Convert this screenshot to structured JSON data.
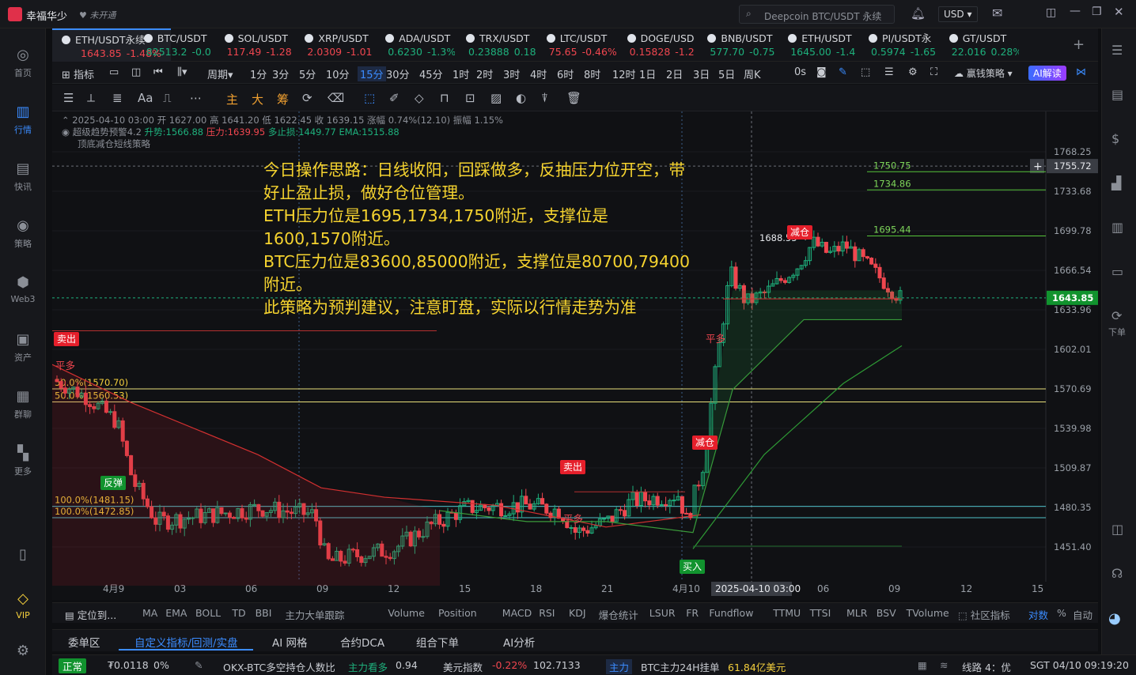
{
  "app": {
    "name": "幸福华少",
    "status": "未开通",
    "search_placeholder": "Deepcoin BTC/USDT 永续",
    "currency": "USD"
  },
  "sidebar": [
    {
      "label": "首页",
      "icon": "home-icon"
    },
    {
      "label": "行情",
      "icon": "market-icon"
    },
    {
      "label": "快讯",
      "icon": "news-icon"
    },
    {
      "label": "策略",
      "icon": "strategy-icon"
    },
    {
      "label": "Web3",
      "icon": "web3-icon"
    },
    {
      "label": "资产",
      "icon": "wallet-icon"
    },
    {
      "label": "群聊",
      "icon": "chat-icon"
    },
    {
      "label": "更多",
      "icon": "more-icon"
    },
    {
      "label": "VIP",
      "icon": "vip-icon"
    }
  ],
  "tabs": [
    {
      "symbol": "ETH/USDT永续",
      "price": "1643.85",
      "change": "-1.48%",
      "dir": "down"
    },
    {
      "symbol": "BTC/USDT",
      "price": "82513.2",
      "change": "-0.0",
      "dir": "up"
    },
    {
      "symbol": "SOL/USDT",
      "price": "117.49",
      "change": "-1.28",
      "dir": "down"
    },
    {
      "symbol": "XRP/USDT",
      "price": "2.0309",
      "change": "-1.01",
      "dir": "down"
    },
    {
      "symbol": "ADA/USDT",
      "price": "0.6230",
      "change": "-1.3%",
      "dir": "up"
    },
    {
      "symbol": "TRX/USDT",
      "price": "0.23888",
      "change": "0.18",
      "dir": "up"
    },
    {
      "symbol": "LTC/USDT",
      "price": "75.65",
      "change": "-0.46%",
      "dir": "down"
    },
    {
      "symbol": "DOGE/USD",
      "price": "0.15828",
      "change": "-1.2",
      "dir": "down"
    },
    {
      "symbol": "BNB/USDT",
      "price": "577.70",
      "change": "-0.75",
      "dir": "up"
    },
    {
      "symbol": "ETH/USDT",
      "price": "1645.00",
      "change": "-1.4",
      "dir": "up"
    },
    {
      "symbol": "PI/USDT永",
      "price": "0.5974",
      "change": "-1.65",
      "dir": "up"
    },
    {
      "symbol": "GT/USDT",
      "price": "22.016",
      "change": "0.28%",
      "dir": "up"
    }
  ],
  "toolbar": {
    "indicator": "指标",
    "period": "周期",
    "intervals": [
      "1分",
      "3分",
      "5分",
      "10分",
      "15分",
      "30分",
      "45分",
      "1时",
      "2时",
      "3时",
      "4时",
      "6时",
      "8时",
      "12时",
      "1日",
      "2日",
      "3日",
      "5日",
      "周K"
    ],
    "selected_interval": "15分",
    "countdown": "0s",
    "earn": "赢钱策略",
    "ai": "AI解读"
  },
  "drawtools": [
    "主",
    "大",
    "筹"
  ],
  "info": {
    "line1": "2025-04-10 03:00 开 1627.00 高 1641.20 低 1622.45 收 1639.15 涨幅 0.74%(12.10) 振幅 1.15%",
    "line2a": "超级趋势预警4.2",
    "line2b": "升势:1566.88",
    "line2c": "压力:1639.95",
    "line2d": "多止损:1449.77",
    "line2e": "EMA:1515.88",
    "line3": "顶底减仓短线策略"
  },
  "strategy_text": "今日操作思路：日线收阳，回踩做多，反抽压力位开空，带好止盈止损，做好仓位管理。\nETH压力位是1695,1734,1750附近，支撑位是1600,1570附近。\nBTC压力位是83600,85000附近，支撑位是80700,79400附近。\n此策略为预判建议，注意盯盘，实际以行情走势为准",
  "chart_data": {
    "type": "candlestick",
    "symbol": "ETH/USDT永续",
    "interval": "15分",
    "y_ticks": [
      1768.25,
      1733.68,
      1699.78,
      1666.54,
      1633.96,
      1602.01,
      1570.69,
      1539.98,
      1509.87,
      1480.35,
      1451.4
    ],
    "x_ticks": [
      "4月9",
      "03",
      "06",
      "09",
      "12",
      "15",
      "18",
      "21",
      "4月10",
      "06",
      "09",
      "12",
      "15"
    ],
    "crosshair_time": "2025-04-10 03:00",
    "crosshair_price": "1755.72",
    "last_price": "1643.85",
    "levels": [
      {
        "label": "1750.75",
        "value": 1750.75
      },
      {
        "label": "1734.86",
        "value": 1734.86
      },
      {
        "label": "1695.44",
        "value": 1695.44
      },
      {
        "label": "50.0%(1570.70)",
        "value": 1570.7
      },
      {
        "label": "50.0%(1560.53)",
        "value": 1560.53
      },
      {
        "label": "100.0%(1481.15)",
        "value": 1481.15
      },
      {
        "label": "100.0%(1472.85)",
        "value": 1472.85
      }
    ],
    "peak_label": "1688.55",
    "signals": [
      "卖出",
      "平多",
      "反弹",
      "卖出",
      "平多",
      "减仓",
      "买入",
      "平多",
      "减仓"
    ],
    "ylim": [
      1436,
      1790
    ]
  },
  "indicators": [
    "MA",
    "EMA",
    "BOLL",
    "TD",
    "BBI",
    "主力大单跟踪",
    "Volume",
    "Position",
    "MACD",
    "RSI",
    "KDJ",
    "爆仓统计",
    "LSUR",
    "FR",
    "Fundflow",
    "TTMU",
    "TTSI",
    "MLR",
    "BSV",
    "TVolume"
  ],
  "indicator_right": [
    "社区指标",
    "对数",
    "%",
    "自动"
  ],
  "locate": "定位到...",
  "bottom_tabs": [
    "委单区",
    "自定义指标/回测/实盘",
    "AI 网格",
    "合约DCA",
    "组合下单",
    "AI分析"
  ],
  "status": {
    "state": "正常",
    "balance": "₮0.0118",
    "pct": "0%",
    "ratio_label": "OKX-BTC多空持仓人数比",
    "ratio_hint": "主力看多",
    "ratio_val": "0.94",
    "usd_label": "美元指数",
    "usd_chg": "-0.22%",
    "usd_val": "102.7133",
    "main_tag": "主力",
    "main_label": "BTC主力24H挂单",
    "main_val": "61.84亿美元",
    "line": "线路 4：优",
    "time": "SGT 04/10 09:19:20"
  }
}
